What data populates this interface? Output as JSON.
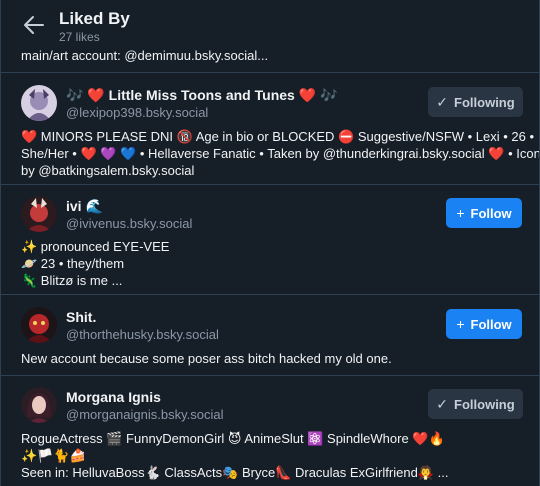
{
  "header": {
    "title": "Liked By",
    "count_label": "27 likes"
  },
  "truncated_bio": "main/art account: @demimuu.bsky.social...",
  "users": [
    {
      "name_left_emoji": "🎶 ❤️",
      "name": "Little Miss Toons and Tunes",
      "name_right_emoji": "❤️ 🎶",
      "handle": "@lexipop398.bsky.social",
      "button_label": "Following",
      "button_icon": "check-icon",
      "bio": [
        "❤️ MINORS PLEASE DNI 🔞 Age in bio or BLOCKED ⛔ Suggestive/NSFW • Lexi • 26 •",
        "She/Her • ❤️ 💜 💙 • Hellaverse Fanatic • Taken by @thunderkingrai.bsky.social ❤️ • Icon",
        "by @batkingsalem.bsky.social"
      ]
    },
    {
      "name": "ivi",
      "name_right_emoji": "🌊",
      "handle": "@ivivenus.bsky.social",
      "button_label": "Follow",
      "button_icon": "plus-icon",
      "bio": [
        "✨ pronounced EYE-VEE",
        "🪐 23 • they/them",
        "🦎 Blitzø is me ..."
      ]
    },
    {
      "name": "Shit.",
      "handle": "@thorthehusky.bsky.social",
      "button_label": "Follow",
      "button_icon": "plus-icon",
      "bio": [
        "New account because some poser ass bitch hacked my old one."
      ]
    },
    {
      "name": "Morgana Ignis",
      "handle": "@morganaignis.bsky.social",
      "button_label": "Following",
      "button_icon": "check-icon",
      "bio": [
        "RogueActress 🎬 FunnyDemonGirl 😈 AnimeSlut ⚛️ SpindleWhore ❤️🔥",
        "✨🏳️🐈🍰",
        "Seen in: HelluvaBoss🐇 ClassActs🎭 Bryce👠 Draculas ExGirlfriend🧛 ..."
      ]
    }
  ],
  "colors": {
    "background": "#161e27",
    "divider": "#2e4052",
    "follow_button": "#1a82f2",
    "following_button": "#2a3544",
    "handle_text": "#8b98a8"
  }
}
